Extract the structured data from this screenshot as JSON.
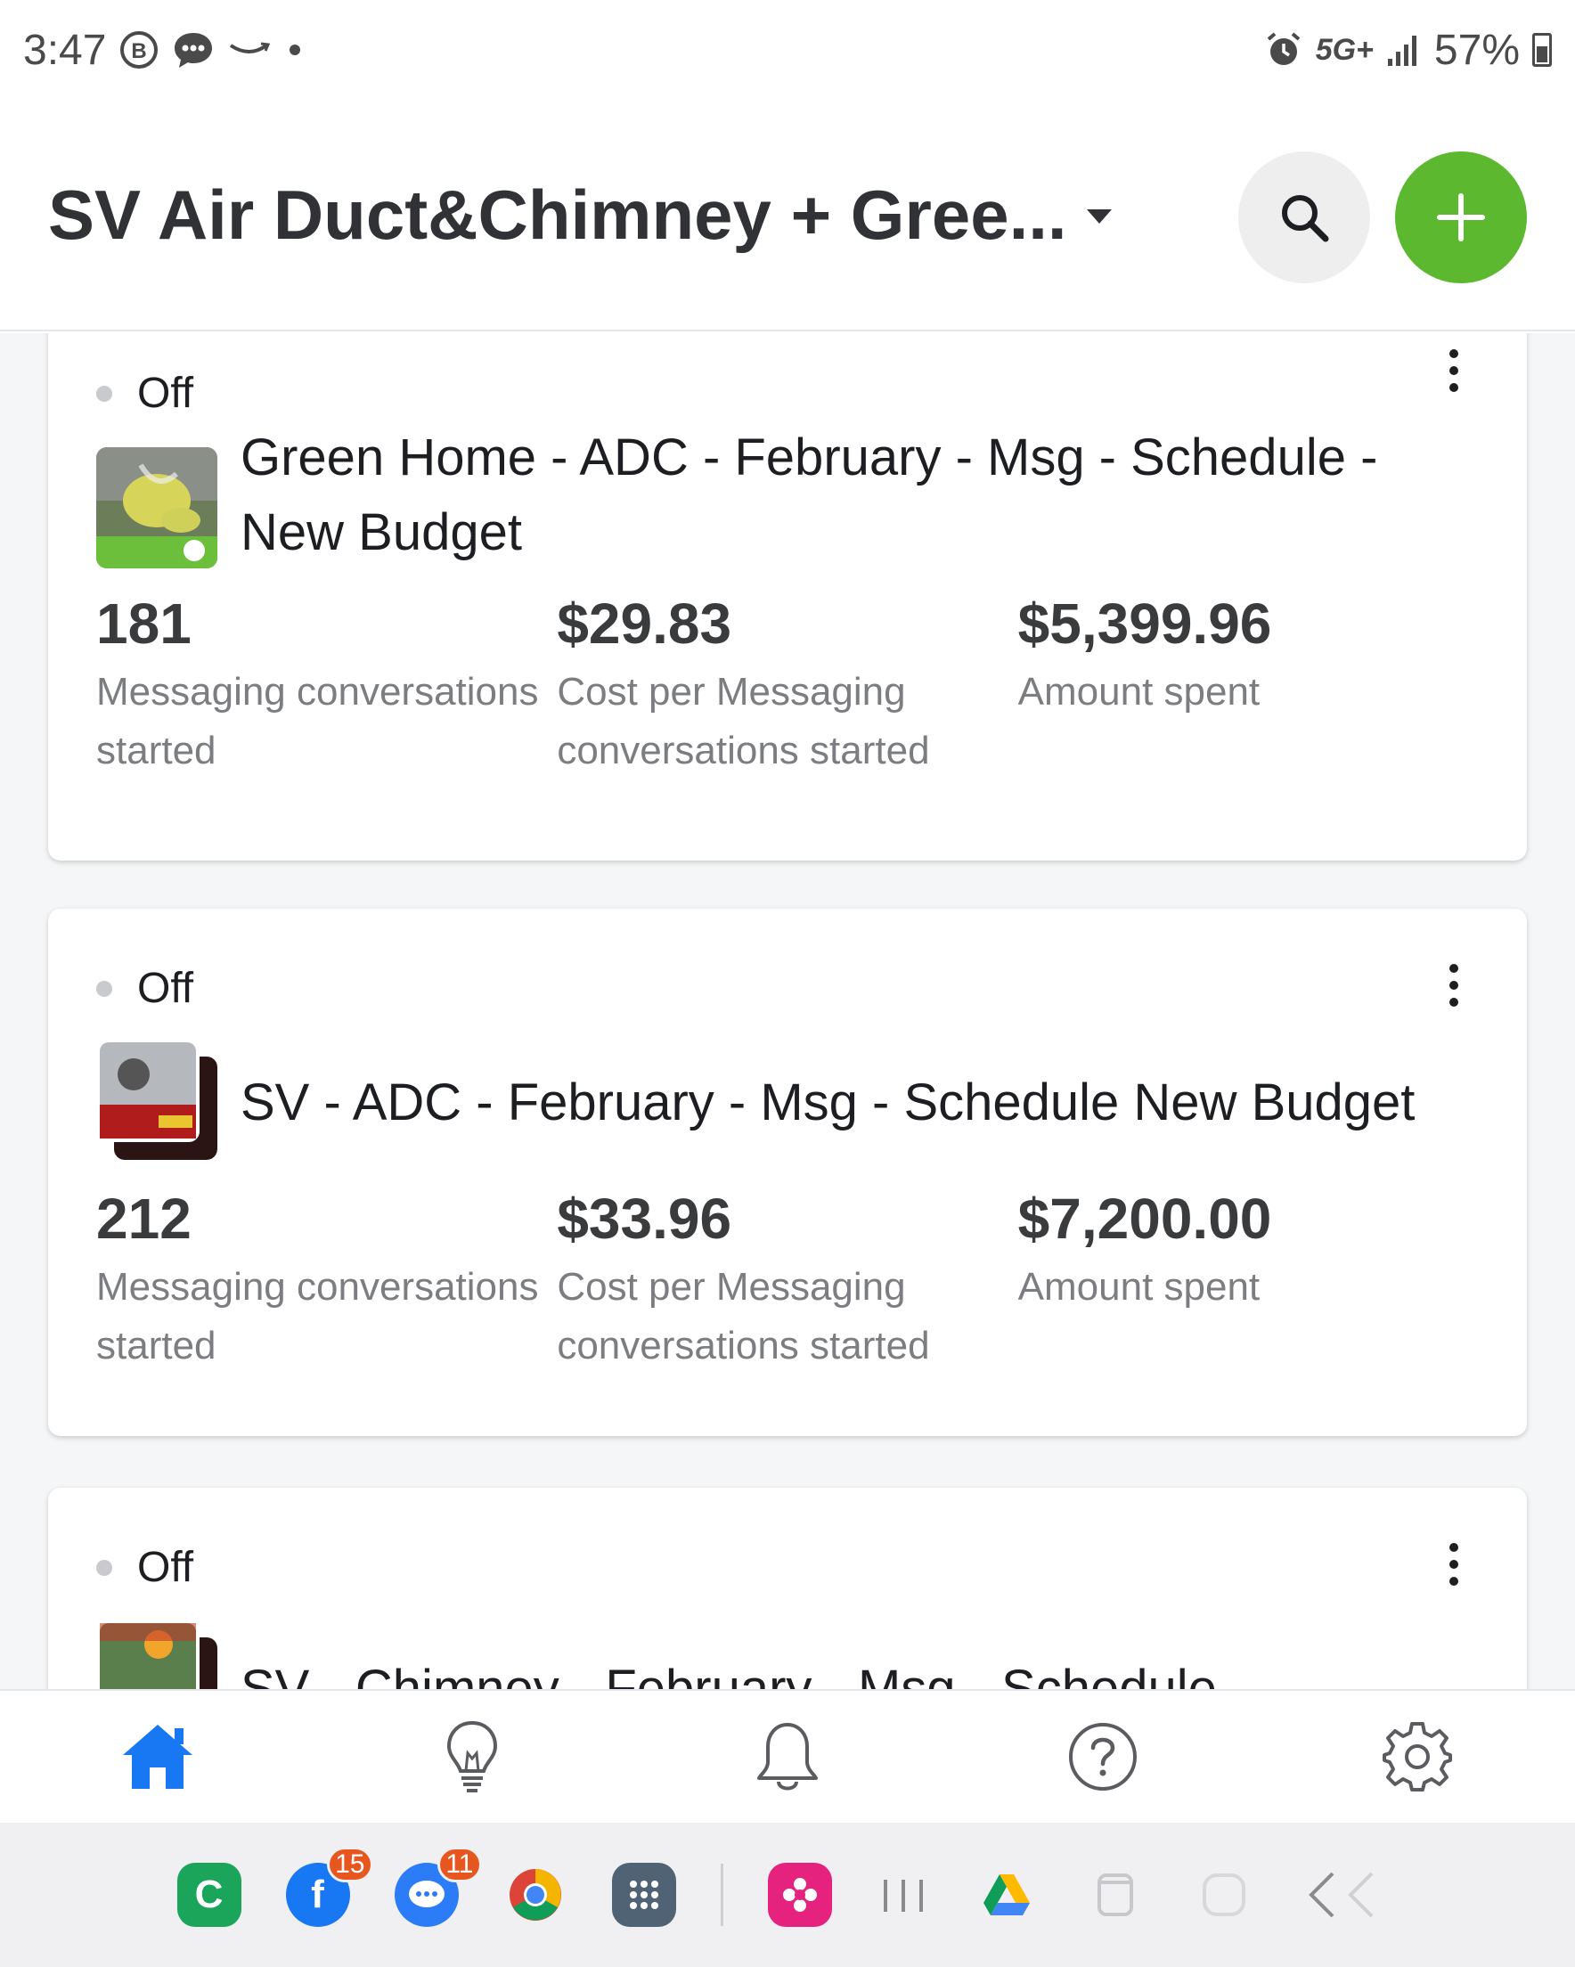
{
  "status_bar": {
    "time": "3:47",
    "network": "5G+",
    "battery": "57%"
  },
  "header": {
    "title": "SV Air Duct&Chimney + Gree...",
    "search_icon": "search-icon",
    "add_icon": "plus-icon",
    "accent_color": "#5cb82f"
  },
  "ads": [
    {
      "status": "Off",
      "name": "Green Home - ADC - February - Msg - Schedule - New Budget",
      "metrics": [
        {
          "value": "181",
          "label": "Messaging conversations started"
        },
        {
          "value": "$29.83",
          "label": "Cost per Messaging conversations started"
        },
        {
          "value": "$5,399.96",
          "label": "Amount spent"
        }
      ]
    },
    {
      "status": "Off",
      "name": "SV - ADC - February - Msg - Schedule New Budget",
      "metrics": [
        {
          "value": "212",
          "label": "Messaging conversations started"
        },
        {
          "value": "$33.96",
          "label": "Cost per Messaging conversations started"
        },
        {
          "value": "$7,200.00",
          "label": "Amount spent"
        }
      ]
    },
    {
      "status": "Off",
      "name": "SV - Chimney - February - Msg - Schedule"
    }
  ],
  "bottom_nav": [
    "home-icon",
    "lightbulb-icon",
    "bell-icon",
    "help-icon",
    "gear-icon"
  ],
  "dock": {
    "facebook_badge": "15",
    "messenger_badge": "11"
  }
}
